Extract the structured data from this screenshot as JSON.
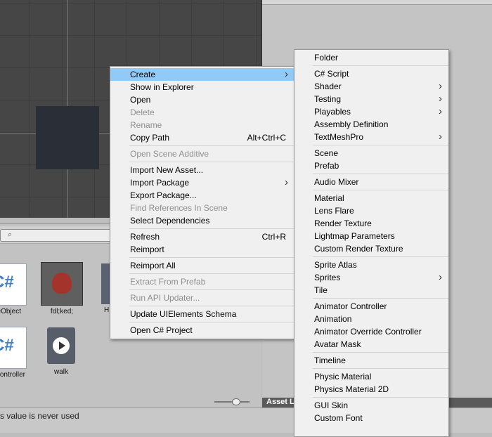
{
  "status": {
    "message": "s value is never used"
  },
  "asset_label_bar": "Asset L",
  "assets": [
    {
      "name": "eObject",
      "type": "csharp"
    },
    {
      "name": "fdl;ked;",
      "type": "sprite"
    },
    {
      "name": "H",
      "type": "partial"
    },
    {
      "name": "ontroller",
      "type": "csharp"
    },
    {
      "name": "walk",
      "type": "animation"
    }
  ],
  "icons": {
    "search": "search-icon",
    "csharp_glyph": "C#"
  },
  "main_menu": [
    {
      "label": "Create",
      "submenu": true,
      "highlighted": true
    },
    {
      "label": "Show in Explorer"
    },
    {
      "label": "Open"
    },
    {
      "label": "Delete",
      "disabled": true
    },
    {
      "label": "Rename",
      "disabled": true
    },
    {
      "label": "Copy Path",
      "shortcut": "Alt+Ctrl+C"
    },
    {
      "sep": true
    },
    {
      "label": "Open Scene Additive",
      "disabled": true
    },
    {
      "sep": true
    },
    {
      "label": "Import New Asset..."
    },
    {
      "label": "Import Package",
      "submenu": true
    },
    {
      "label": "Export Package..."
    },
    {
      "label": "Find References In Scene",
      "disabled": true
    },
    {
      "label": "Select Dependencies"
    },
    {
      "sep": true
    },
    {
      "label": "Refresh",
      "shortcut": "Ctrl+R"
    },
    {
      "label": "Reimport"
    },
    {
      "sep": true
    },
    {
      "label": "Reimport All"
    },
    {
      "sep": true
    },
    {
      "label": "Extract From Prefab",
      "disabled": true
    },
    {
      "sep": true
    },
    {
      "label": "Run API Updater...",
      "disabled": true
    },
    {
      "sep": true
    },
    {
      "label": "Update UIElements Schema"
    },
    {
      "sep": true
    },
    {
      "label": "Open C# Project"
    }
  ],
  "create_menu": [
    {
      "label": "Folder"
    },
    {
      "sep": true
    },
    {
      "label": "C# Script"
    },
    {
      "label": "Shader",
      "submenu": true
    },
    {
      "label": "Testing",
      "submenu": true
    },
    {
      "label": "Playables",
      "submenu": true
    },
    {
      "label": "Assembly Definition"
    },
    {
      "label": "TextMeshPro",
      "submenu": true
    },
    {
      "sep": true
    },
    {
      "label": "Scene"
    },
    {
      "label": "Prefab"
    },
    {
      "sep": true
    },
    {
      "label": "Audio Mixer"
    },
    {
      "sep": true
    },
    {
      "label": "Material"
    },
    {
      "label": "Lens Flare"
    },
    {
      "label": "Render Texture"
    },
    {
      "label": "Lightmap Parameters"
    },
    {
      "label": "Custom Render Texture"
    },
    {
      "sep": true
    },
    {
      "label": "Sprite Atlas"
    },
    {
      "label": "Sprites",
      "submenu": true
    },
    {
      "label": "Tile"
    },
    {
      "sep": true
    },
    {
      "label": "Animator Controller"
    },
    {
      "label": "Animation"
    },
    {
      "label": "Animator Override Controller"
    },
    {
      "label": "Avatar Mask"
    },
    {
      "sep": true
    },
    {
      "label": "Timeline"
    },
    {
      "sep": true
    },
    {
      "label": "Physic Material"
    },
    {
      "label": "Physics Material 2D"
    },
    {
      "sep": true
    },
    {
      "label": "GUI Skin"
    },
    {
      "label": "Custom Font"
    }
  ]
}
